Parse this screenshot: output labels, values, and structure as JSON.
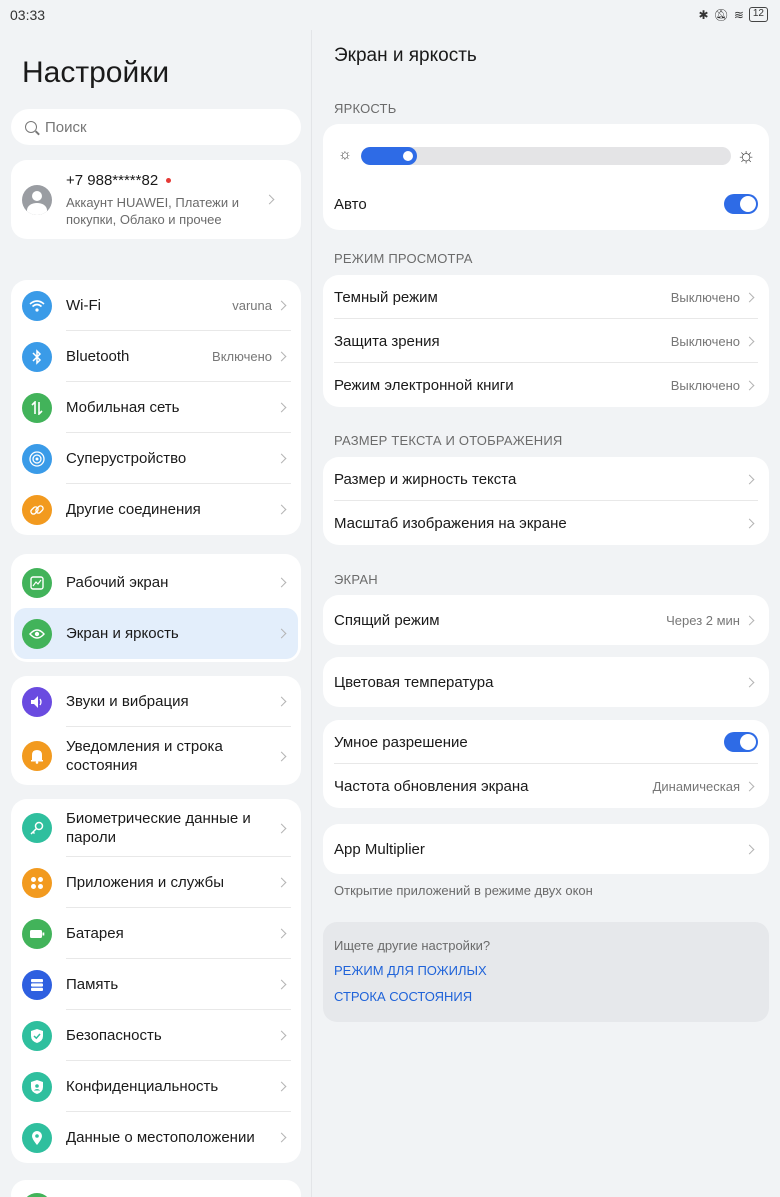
{
  "status": {
    "time": "03:33",
    "battery": "12"
  },
  "left": {
    "title": "Настройки",
    "search_placeholder": "Поиск",
    "account": {
      "phone": "+7 988*****82",
      "sub": "Аккаунт HUAWEI, Платежи и покупки, Облако и прочее"
    },
    "group1": [
      {
        "label": "Wi-Fi",
        "value": "varuna",
        "icon": "wifi-icon",
        "color": "#3a9be8"
      },
      {
        "label": "Bluetooth",
        "value": "Включено",
        "icon": "bluetooth-icon",
        "color": "#3a9be8"
      },
      {
        "label": "Мобильная сеть",
        "value": "",
        "icon": "mobile-network-icon",
        "color": "#42b35a"
      },
      {
        "label": "Суперустройство",
        "value": "",
        "icon": "super-device-icon",
        "color": "#3a9be8"
      },
      {
        "label": "Другие соединения",
        "value": "",
        "icon": "link-icon",
        "color": "#f29a1f"
      }
    ],
    "group2": [
      {
        "label": "Рабочий экран",
        "icon": "home-screen-icon",
        "color": "#42b35a"
      },
      {
        "label": "Экран и яркость",
        "icon": "eye-icon",
        "color": "#42b35a"
      }
    ],
    "group3": [
      {
        "label": "Звуки и вибрация",
        "icon": "sound-icon",
        "color": "#6a4be0"
      },
      {
        "label": "Уведомления и строка состояния",
        "icon": "bell-icon",
        "color": "#f29a1f"
      }
    ],
    "group4": [
      {
        "label": "Биометрические данные и пароли",
        "icon": "key-icon",
        "color": "#2fbf9e"
      },
      {
        "label": "Приложения и службы",
        "icon": "apps-icon",
        "color": "#f29a1f"
      },
      {
        "label": "Батарея",
        "icon": "battery-icon",
        "color": "#42b35a"
      },
      {
        "label": "Память",
        "icon": "storage-icon",
        "color": "#2e5fe0"
      },
      {
        "label": "Безопасность",
        "icon": "shield-icon",
        "color": "#2fbf9e"
      },
      {
        "label": "Конфиденциальность",
        "icon": "privacy-icon",
        "color": "#2fbf9e"
      },
      {
        "label": "Данные о местоположении",
        "icon": "location-icon",
        "color": "#2fbf9e"
      }
    ]
  },
  "right": {
    "title": "Экран и яркость",
    "brightness_header": "ЯРКОСТЬ",
    "brightness_level": 0.15,
    "auto_label": "Авто",
    "auto_on": true,
    "view_header": "РЕЖИМ ПРОСМОТРА",
    "view_rows": [
      {
        "label": "Темный режим",
        "value": "Выключено"
      },
      {
        "label": "Защита зрения",
        "value": "Выключено"
      },
      {
        "label": "Режим электронной книги",
        "value": "Выключено"
      }
    ],
    "text_header": "РАЗМЕР ТЕКСТА И ОТОБРАЖЕНИЯ",
    "text_rows": [
      {
        "label": "Размер и жирность текста"
      },
      {
        "label": "Масштаб изображения на экране"
      }
    ],
    "screen_header": "ЭКРАН",
    "sleep": {
      "label": "Спящий режим",
      "value": "Через 2 мин"
    },
    "color_temp": {
      "label": "Цветовая температура"
    },
    "smart_res": {
      "label": "Умное разрешение",
      "on": true
    },
    "refresh": {
      "label": "Частота обновления экрана",
      "value": "Динамическая"
    },
    "app_multiplier": {
      "label": "App Multiplier",
      "note": "Открытие приложений в режиме двух окон"
    },
    "more": {
      "header": "Ищете другие настройки?",
      "link1": "РЕЖИМ ДЛЯ ПОЖИЛЫХ",
      "link2": "СТРОКА СОСТОЯНИЯ"
    }
  }
}
